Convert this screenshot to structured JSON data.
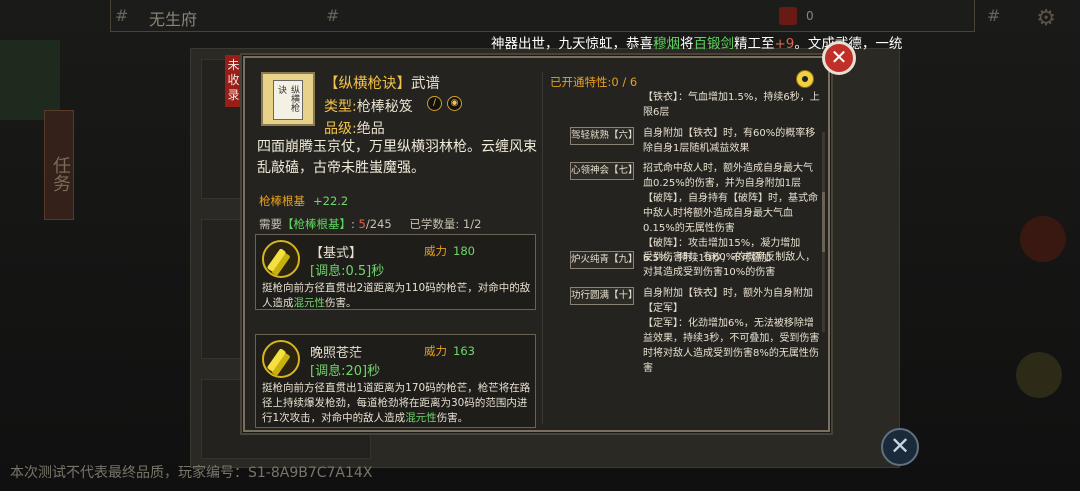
{
  "header": {
    "city": "无生府",
    "bag_count": "0"
  },
  "background": {
    "left_tab": "任务",
    "footer_note": "本次测试不代表最终品质，玩家编号：S1-8A9B7C7A14X"
  },
  "announcement": {
    "prefix": "神器出世，九天惊虹，恭喜",
    "player": "穆烟",
    "mid": "将",
    "item": "百锻剑",
    "mid2": "精工至",
    "level": "+9",
    "suffix": "。文成武德，一统"
  },
  "dialog": {
    "uncollected": "未收录",
    "close_label": "✕",
    "book_spine": "纵横枪诀",
    "skill": {
      "name": "【纵横枪诀】",
      "kind": "武谱",
      "type_label": "类型:",
      "type_value": "枪棒秘笈",
      "grade_label": "品级:",
      "grade_value": "绝品",
      "poem": "四面崩腾玉京仗，万里纵横羽林枪。云缠风束乱敲磕，古帝未胜蚩魔强。",
      "root_bonus_label": "枪棒根基",
      "root_bonus_value": "+22.2",
      "need_prefix": "需要",
      "need_root": "【枪棒根基】",
      "need_colon": ":",
      "need_current": "5",
      "need_total": "/245",
      "learned_label": "已学数量:",
      "learned_value": "1/2"
    },
    "moves": [
      {
        "title": "【基式】",
        "power_label": "威力",
        "power_value": "180",
        "cd_prefix": "[调息:",
        "cd_value": "0.5",
        "cd_suffix": "]秒",
        "desc_1": "挺枪向前方径直贯出2道距离为110码的枪芒，对命中的敌人造成",
        "desc_hl": "混元性",
        "desc_2": "伤害。"
      },
      {
        "title": "晚照苍茫",
        "power_label": "威力",
        "power_value": "163",
        "cd_prefix": "[调息:",
        "cd_value": "20",
        "cd_suffix": "]秒",
        "desc_1": "挺枪向前方径直贯出1道距离为170码的枪芒，枪芒将在路径上持续爆发枪劲，每道枪劲将在距离为30码的范围内进行1次攻击，对命中的敌人造成",
        "desc_hl": "混元性",
        "desc_2": "伤害。"
      }
    ],
    "traits_header": "已开通特性:0 / 6",
    "traits": [
      {
        "button": "",
        "text": "【铁衣】：气血增加1.5%，持续6秒，上限6层"
      },
      {
        "button": "驾轻就熟【六】",
        "text": "自身附加【铁衣】时，有60%的概率移除自身1层随机减益效果"
      },
      {
        "button": "心领神会【七】",
        "text": "招式命中敌人时，额外造成自身最大气血0.25%的伤害，并为自身附加1层【破阵】，自身持有【破阵】时，基式命中敌人时将额外造成自身最大气血0.15%的无属性伤害\n【破阵】：攻击增加15%，凝力增加6.5%，持续10秒，不可叠加"
      },
      {
        "button": "炉火纯青【九】",
        "text": "受到伤害时，有60%的概率反制敌人，对其造成受到伤害10%的伤害"
      },
      {
        "button": "功行圆满【十】",
        "text": "自身附加【铁衣】时，额外为自身附加【定军】\n【定军】：化劲增加6%，无法被移除增益效果，持续3秒，不可叠加，受到伤害时将对敌人造成受到伤害8%的无属性伤害"
      }
    ]
  },
  "icons": {
    "close": "close-icon",
    "eye": "eye-icon",
    "gear": "gear-icon",
    "spear": "spear-icon"
  }
}
